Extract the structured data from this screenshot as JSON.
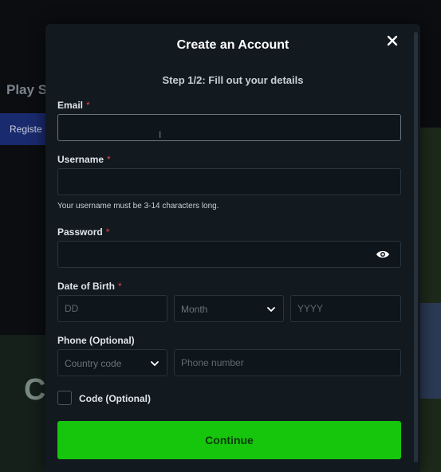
{
  "background": {
    "title_fragment": "Play S",
    "tab_fragment": "Registe",
    "big_letter": "C"
  },
  "modal": {
    "title": "Create an Account",
    "step": "Step 1/2: Fill out your details",
    "close_icon": "close-icon"
  },
  "form": {
    "email": {
      "label": "Email",
      "required": "*",
      "value": ""
    },
    "username": {
      "label": "Username",
      "required": "*",
      "value": "",
      "hint": "Your username must be 3-14 characters long."
    },
    "password": {
      "label": "Password",
      "required": "*",
      "value": "",
      "toggle_icon": "eye-icon"
    },
    "dob": {
      "label": "Date of Birth",
      "required": "*",
      "day_placeholder": "DD",
      "month_selected": "Month",
      "year_placeholder": "YYYY"
    },
    "phone": {
      "label": "Phone (Optional)",
      "country_code_selected": "Country code",
      "number_placeholder": "Phone number"
    },
    "code": {
      "label": "Code (Optional)",
      "checked": false
    }
  },
  "actions": {
    "continue_label": "Continue"
  },
  "colors": {
    "primary_button": "#16c60c",
    "modal_bg": "#12191f",
    "required_asterisk": "#e0434b"
  }
}
